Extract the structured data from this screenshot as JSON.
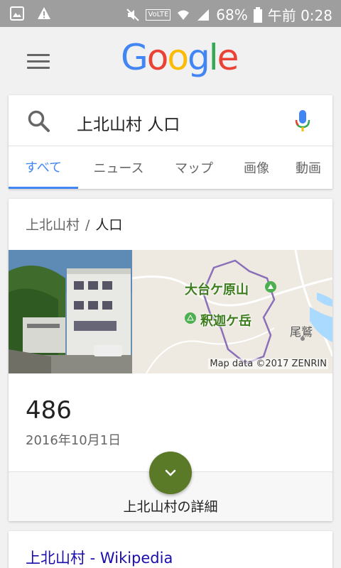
{
  "status_bar": {
    "battery": "68%",
    "time": "午前 0:28",
    "volte": "VoLTE"
  },
  "logo": {
    "letters": [
      "G",
      "o",
      "o",
      "g",
      "l",
      "e"
    ],
    "colors": [
      "#4285f4",
      "#ea4335",
      "#fbbc05",
      "#4285f4",
      "#34a853",
      "#ea4335"
    ]
  },
  "search": {
    "query": "上北山村 人口"
  },
  "tabs": [
    {
      "label": "すべて",
      "active": true
    },
    {
      "label": "ニュース",
      "active": false
    },
    {
      "label": "マップ",
      "active": false
    },
    {
      "label": "画像",
      "active": false
    },
    {
      "label": "動画",
      "active": false
    }
  ],
  "result": {
    "breadcrumb": [
      "上北山村",
      "人口"
    ],
    "breadcrumb_sep": "/",
    "map_labels": {
      "peak1": "大台ケ原山",
      "peak2": "釈迦ケ岳",
      "town": "尾鷲"
    },
    "map_credit": "Map data ©2017 ZENRIN",
    "population": "486",
    "date": "2016年10月1日",
    "details_link": "上北山村の詳細"
  },
  "wiki": {
    "title": "上北山村 - Wikipedia"
  },
  "colors": {
    "accent": "#4285f4",
    "expand_button": "#5b7a27",
    "link": "#1a0dab"
  }
}
